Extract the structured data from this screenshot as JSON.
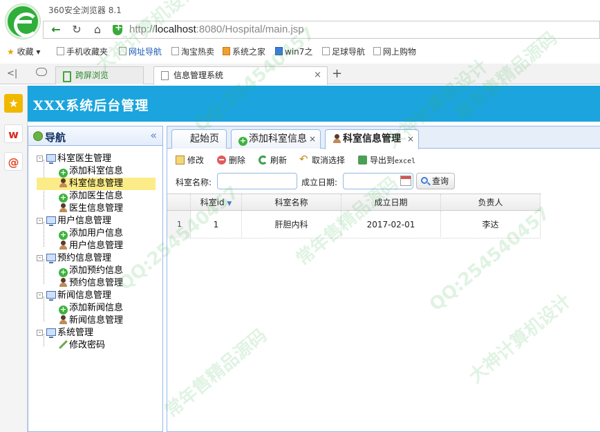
{
  "browser": {
    "title": "360安全浏览器 8.1",
    "url_scheme": "http://",
    "url_host": "localhost",
    "url_rest": ":8080/Hospital/main.jsp"
  },
  "bookmarks": [
    {
      "label": "收藏"
    },
    {
      "label": "手机收藏夹"
    },
    {
      "label": "网址导航"
    },
    {
      "label": "淘宝热卖"
    },
    {
      "label": "系统之家"
    },
    {
      "label": "win7之"
    },
    {
      "label": "足球导航"
    },
    {
      "label": "网上购物"
    }
  ],
  "browser_tabs": [
    {
      "label": "跨屏浏览"
    },
    {
      "label": "信息管理系统"
    }
  ],
  "app": {
    "title": "XXX系统后台管理"
  },
  "nav": {
    "title": "导航",
    "groups": [
      {
        "label": "科室医生管理",
        "children": [
          "添加科室信息",
          "科室信息管理",
          "添加医生信息",
          "医生信息管理"
        ]
      },
      {
        "label": "用户信息管理",
        "children": [
          "添加用户信息",
          "用户信息管理"
        ]
      },
      {
        "label": "预约信息管理",
        "children": [
          "添加预约信息",
          "预约信息管理"
        ]
      },
      {
        "label": "新闻信息管理",
        "children": [
          "添加新闻信息",
          "新闻信息管理"
        ]
      },
      {
        "label": "系统管理",
        "children": [
          "修改密码"
        ]
      }
    ]
  },
  "content_tabs": [
    {
      "label": "起始页"
    },
    {
      "label": "添加科室信息"
    },
    {
      "label": "科室信息管理"
    }
  ],
  "toolbar": {
    "edit": "修改",
    "delete": "删除",
    "refresh": "刷新",
    "unselect": "取消选择",
    "export_prefix": "导出到",
    "export_suffix": "excel"
  },
  "search": {
    "name_label": "科室名称:",
    "date_label": "成立日期:",
    "name_value": "",
    "date_value": "",
    "query": "查询"
  },
  "grid": {
    "columns": [
      "科室id",
      "科室名称",
      "成立日期",
      "负责人"
    ],
    "rows": [
      {
        "num": "1",
        "id": "1",
        "name": "肝胆内科",
        "date": "2017-02-01",
        "leader": "李达"
      }
    ]
  },
  "watermark": {
    "lines": [
      "大神计算机设计",
      "QQ:254540457",
      "常年售精品源码"
    ]
  },
  "colors": {
    "header": "#1ba4dd",
    "panel_border": "#95b8e7",
    "selected_node": "#fbec88"
  }
}
